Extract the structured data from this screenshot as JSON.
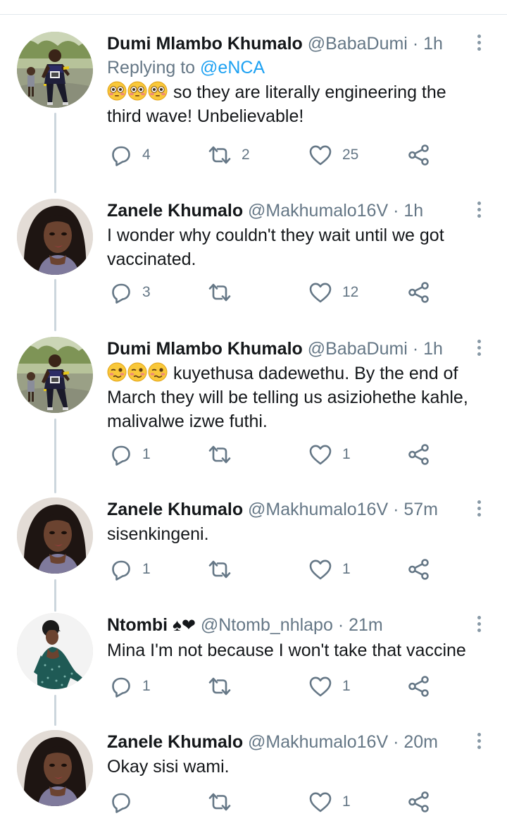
{
  "tweets": [
    {
      "name": "Dumi Mlambo Khumalo",
      "handle": "@BabaDumi",
      "separator": "·",
      "time": "1h",
      "replying_to_label": "Replying to",
      "replying_to_handle": "@eNCA",
      "emoji": [
        "flushed-face-emoji",
        "flushed-face-emoji",
        "flushed-face-emoji"
      ],
      "text": "so they are literally engineering the third wave! Unbelievable!",
      "replies": "4",
      "retweets": "2",
      "likes": "25"
    },
    {
      "name": "Zanele Khumalo",
      "handle": "@Makhumalo16V",
      "separator": "·",
      "time": "1h",
      "text": "I wonder why couldn't they wait until we got vaccinated.",
      "replies": "3",
      "retweets": "",
      "likes": "12"
    },
    {
      "name": "Dumi Mlambo Khumalo",
      "handle": "@BabaDumi",
      "separator": "·",
      "time": "1h",
      "emoji": [
        "woozy-face-emoji",
        "woozy-face-emoji",
        "woozy-face-emoji"
      ],
      "text": "kuyethusa dadewethu. By the end of March they will be telling us asiziohethe kahle, malivalwe izwe futhi.",
      "replies": "1",
      "retweets": "",
      "likes": "1"
    },
    {
      "name": "Zanele Khumalo",
      "handle": "@Makhumalo16V",
      "separator": "·",
      "time": "57m",
      "text": "sisenkingeni.",
      "replies": "1",
      "retweets": "",
      "likes": "1"
    },
    {
      "name": "Ntombi",
      "name_symbols": "♠❤",
      "handle": "@Ntomb_nhlapo",
      "separator": "·",
      "time": "21m",
      "text": "Mina I'm not because I won't take that vaccine",
      "replies": "1",
      "retweets": "",
      "likes": "1"
    },
    {
      "name": "Zanele Khumalo",
      "handle": "@Makhumalo16V",
      "separator": "·",
      "time": "20m",
      "text": "Okay sisi wami.",
      "replies": "",
      "retweets": "",
      "likes": "1"
    }
  ],
  "icons": {
    "reply": "reply-icon",
    "retweet": "retweet-icon",
    "like": "heart-icon",
    "share": "share-icon",
    "more": "more-options-icon"
  },
  "colors": {
    "name": "#14171a",
    "secondary": "#657786",
    "link": "#1da1f2",
    "thread_line": "#ccd6dd",
    "icon": "#657786"
  }
}
